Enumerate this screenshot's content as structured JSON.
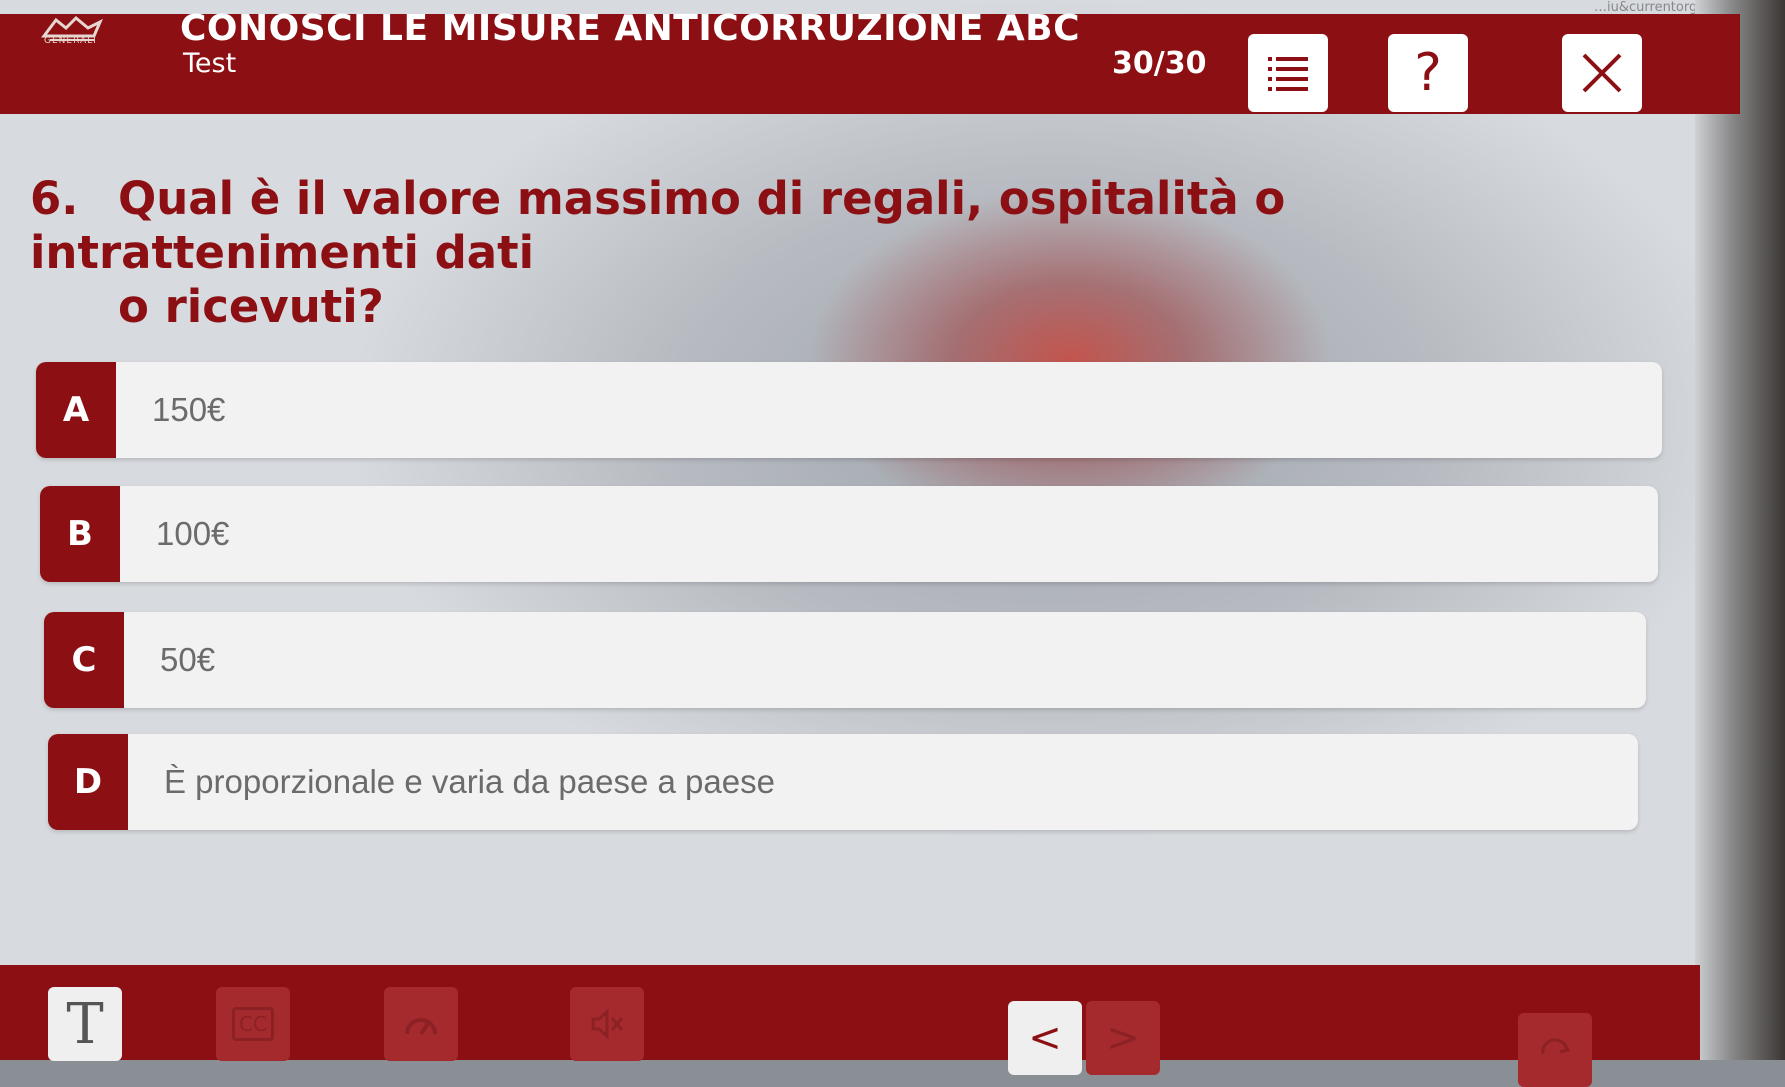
{
  "browser": {
    "url_fragment": "…iu&currentorg=&scoid…"
  },
  "header": {
    "logo_text": "GENERALI",
    "course_title": "CONOSCI LE MISURE ANTICORRUZIONE ABC",
    "course_subtitle": "Test",
    "progress": "30/30",
    "buttons": {
      "menu_icon": "list-icon",
      "help_label": "?",
      "close_icon": "close-icon"
    }
  },
  "question": {
    "number": "6.",
    "line1": "Qual è il valore massimo di regali, ospitalità o intrattenimenti dati",
    "line2": "o ricevuti?"
  },
  "answers": [
    {
      "letter": "A",
      "label": "150€"
    },
    {
      "letter": "B",
      "label": "100€"
    },
    {
      "letter": "C",
      "label": "50€"
    },
    {
      "letter": "D",
      "label": "È proporzionale e varia da paese a paese"
    }
  ],
  "footer": {
    "text_size_label": "T",
    "icons": [
      "text-size-icon",
      "captions-icon",
      "speed-icon",
      "mute-icon",
      "prev-icon",
      "next-icon",
      "reload-icon"
    ],
    "prev_label": "<",
    "next_label": ">",
    "captions_label": "CC"
  },
  "colors": {
    "brand": "#8b0f13",
    "answer_bg": "#f2f2f3",
    "answer_text": "#6b6b6b"
  }
}
